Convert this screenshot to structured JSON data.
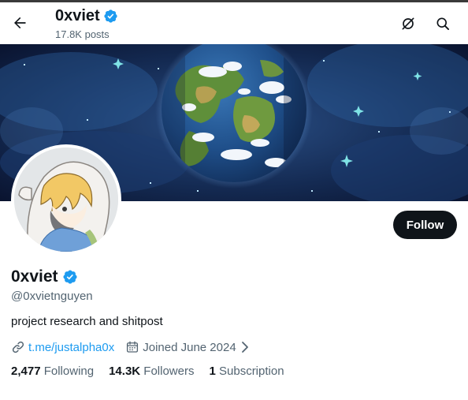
{
  "header": {
    "name": "0xviet",
    "posts": "17.8K posts",
    "back_icon": "arrow-left-icon",
    "icons": [
      "grok-icon",
      "search-icon"
    ]
  },
  "profile": {
    "name": "0xviet",
    "handle": "@0xvietnguyen",
    "bio": "project research and shitpost",
    "link": "t.me/justalpha0x",
    "joined": "Joined June 2024",
    "follow_label": "Follow"
  },
  "stats": {
    "following_count": "2,477",
    "following_label": "Following",
    "followers_count": "14.3K",
    "followers_label": "Followers",
    "subscriptions_count": "1",
    "subscriptions_label": "Subscription"
  },
  "colors": {
    "accent": "#1d9bf0",
    "text": "#0f1419",
    "muted": "#536471",
    "verified": "#1d9bf0",
    "follow_bg": "#0f1419"
  }
}
